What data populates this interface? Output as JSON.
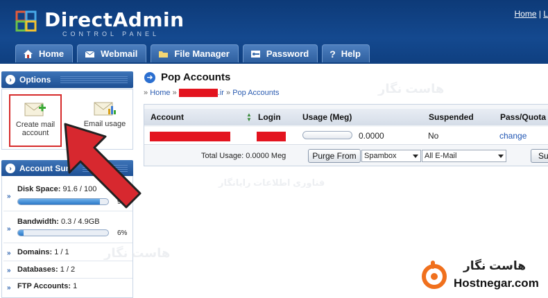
{
  "app": {
    "logo_text": "DirectAdmin",
    "logo_sub": "CONTROL PANEL"
  },
  "toplinks": {
    "home": "Home",
    "logout": "L"
  },
  "tabs": [
    {
      "label": "Home",
      "icon": "house-icon"
    },
    {
      "label": "Webmail",
      "icon": "envelope-icon"
    },
    {
      "label": "File Manager",
      "icon": "folder-icon"
    },
    {
      "label": "Password",
      "icon": "key-icon"
    },
    {
      "label": "Help",
      "icon": "question-icon"
    }
  ],
  "options": {
    "title": "Options",
    "create_mail": {
      "line1": "Create mail",
      "line2": "account"
    },
    "email_usage": "Email usage"
  },
  "account_summary": {
    "title": "Account Sum",
    "disk": {
      "label": "Disk Space:",
      "value": "91.6 / 100",
      "percent": 91,
      "percent_text": "91%"
    },
    "bandwidth": {
      "label": "Bandwidth:",
      "value": "0.3 / 4.9GB",
      "percent": 6,
      "percent_text": "6%"
    },
    "domains": {
      "label": "Domains:",
      "value": "1 / 1"
    },
    "databases": {
      "label": "Databases:",
      "value": "1 / 2"
    },
    "ftp": {
      "label": "FTP Accounts:",
      "value": "1"
    }
  },
  "main": {
    "title": "Pop Accounts",
    "breadcrumb": {
      "home": "Home",
      "domain_suffix": ".ir",
      "current": "Pop Accounts"
    },
    "columns": [
      "Account",
      "Login",
      "Usage (Meg)",
      "Suspended",
      "Pass/Quota"
    ],
    "row": {
      "usage": "0.0000",
      "suspended": "No",
      "action": "change"
    },
    "footer": {
      "total": "Total Usage: 0.0000 Meg",
      "purge": "Purge From",
      "select1": "Spambox",
      "select2": "All E-Mail",
      "submit": "Su"
    }
  },
  "watermark": {
    "fa": "هاست نگار",
    "fa2": "فناوری اطلاعات رایانگار"
  },
  "brand": {
    "fa": "هاست نگار",
    "en": "Hostnegar.com"
  },
  "colors": {
    "header": "#14498f",
    "tab": "#3a6eae",
    "accent_red": "#d62a2a",
    "link": "#1f55b3"
  }
}
